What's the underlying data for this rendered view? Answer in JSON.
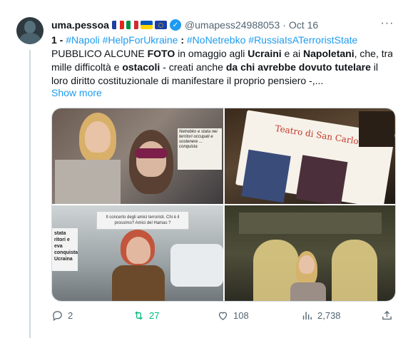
{
  "author": {
    "name": "uma.pessoa",
    "handle": "@umapess24988053",
    "separator": "·",
    "date": "Oct 16",
    "flags": [
      "france-flag",
      "italy-flag",
      "ukraine-flag",
      "eu-flag"
    ],
    "verified": true
  },
  "body": {
    "line1": {
      "num": "1 - ",
      "tag1": "#Napoli",
      "tag2": "#HelpForUkraine",
      "sep": " : ",
      "tag3": "#NoNetrebko",
      "tag4": "#RussiaIsATerroristState"
    },
    "line2": {
      "a": "PUBBLICO ALCUNE ",
      "b": "FOTO",
      "c": " in omaggio agli ",
      "d": "Ucraini",
      "e": " e ai ",
      "f": "Napoletani",
      "g": ", che, tra"
    },
    "line3": {
      "a": "mille difficoltà e ",
      "b": "ostacoli",
      "c": " - creati anche ",
      "d": "da chi avrebbe dovuto tutelare",
      "e": " il"
    },
    "line4": "loro diritto costituzionale di manifestare il proprio pensiero -,..."
  },
  "show_more": "Show more",
  "media": {
    "photo1_sign": "Netrebko e stata nei territori occupati e sostenere ... conquista",
    "photo2_title": "Teatro di San Carlo",
    "photo3_banner": "Il concerto degli amici terroristi. Chi è il prossimo? Amici del Hamas ?",
    "photo3_side": "stata ritori e eva conquista Ucraina"
  },
  "actions": {
    "replies": "2",
    "retweets": "27",
    "likes": "108",
    "views": "2,738"
  },
  "colors": {
    "accent": "#1d9bf0",
    "retweet": "#00ba7c",
    "muted": "#536471"
  }
}
